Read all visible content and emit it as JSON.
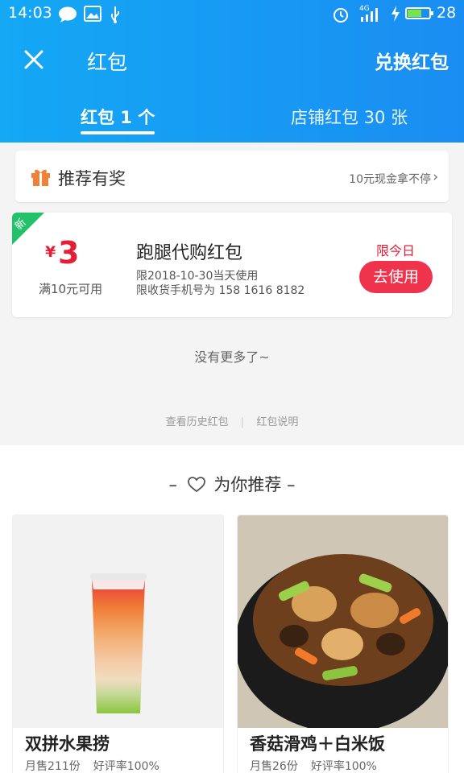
{
  "status_bar": {
    "time": "14:03",
    "network": "4G",
    "battery_level": "28"
  },
  "header": {
    "title": "红包",
    "redeem_label": "兑换红包"
  },
  "tabs": [
    {
      "label": "红包 1 个",
      "active": true
    },
    {
      "label": "店铺红包 30 张",
      "active": false
    }
  ],
  "recommend_bar": {
    "label": "推荐有奖",
    "promo": "10元现金拿不停"
  },
  "coupon": {
    "badge": "新",
    "currency": "¥",
    "amount": "3",
    "min_spend": "满10元可用",
    "name": "跑腿代购红包",
    "valid_date": "限2018-10-30当天使用",
    "phone_limit": "限收货手机号为 158 1616 8182",
    "today_only": "限今日",
    "use_label": "去使用"
  },
  "no_more": "没有更多了~",
  "footer_links": {
    "history": "查看历史红包",
    "explain": "红包说明"
  },
  "recommend_section": {
    "title": "为你推荐",
    "products": [
      {
        "name": "双拼水果捞",
        "monthly_sales": "月售211份",
        "rating": "好评率100%"
      },
      {
        "name": "香菇滑鸡＋白米饭",
        "monthly_sales": "月售26份",
        "rating": "好评率100%"
      }
    ]
  },
  "colors": {
    "header_blue": "#1a9af4",
    "accent_red": "#f0334c",
    "badge_green": "#22c26a"
  },
  "icons": [
    "close-icon",
    "gift-icon",
    "chevron-right-icon",
    "heart-icon",
    "message-icon",
    "image-icon",
    "usb-icon",
    "alarm-icon",
    "signal-icon",
    "charging-icon",
    "battery-icon"
  ]
}
